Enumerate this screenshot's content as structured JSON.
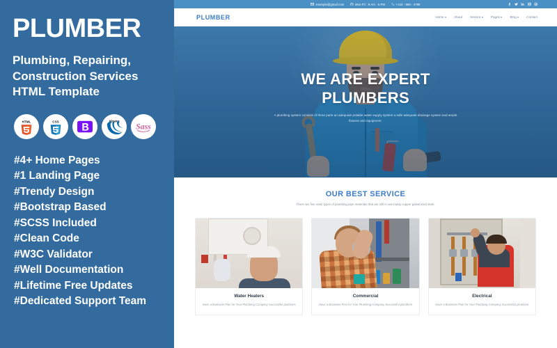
{
  "promo": {
    "title": "PLUMBER",
    "subtitle_lines": [
      "Plumbing, Repairing,",
      "Construction Services",
      "HTML Template"
    ],
    "badges": [
      {
        "name": "html5-badge",
        "label": "HTML5"
      },
      {
        "name": "css3-badge",
        "label": "CSS3"
      },
      {
        "name": "bootstrap-badge",
        "label": "Bootstrap"
      },
      {
        "name": "jquery-badge",
        "label": "jQuery"
      },
      {
        "name": "sass-badge",
        "label": "Sass"
      }
    ],
    "features": [
      "#4+ Home Pages",
      "#1 Landing Page",
      "#Trendy Design",
      "#Bootstrap Based",
      "#SCSS Included",
      "#Clean Code",
      "#W3C Validator",
      "#Well Documentation",
      "#Lifetime Free Updates",
      "#Dedicated Support Team"
    ],
    "background_color": "#336b9e"
  },
  "preview": {
    "topbar": {
      "email": "example@gmail.com",
      "hours": "Mon-Fri : 9 Am - 5 PM",
      "phone": "+123 - 666 - 4789",
      "background_color": "#4a90c4",
      "socials": [
        "facebook-icon",
        "twitter-icon",
        "linkedin-icon",
        "instagram-icon",
        "pinterest-icon"
      ]
    },
    "navbar": {
      "logo": "PLUMBER",
      "logo_color": "#3d7cc9",
      "links": [
        {
          "label": "Home",
          "has_caret": true
        },
        {
          "label": "About",
          "has_caret": false
        },
        {
          "label": "Service",
          "has_caret": true
        },
        {
          "label": "Pages",
          "has_caret": true
        },
        {
          "label": "Blog",
          "has_caret": true
        },
        {
          "label": "Contact",
          "has_caret": false
        }
      ]
    },
    "hero": {
      "heading_line1": "WE ARE EXPERT",
      "heading_line2": "PLUMBERS",
      "paragraph": "A plumbing system consists of three parts an adequate potable water supply system a safe adequate drainage system and ample fixtures and equipment."
    },
    "service": {
      "title": "OUR BEST SERVICE",
      "subtitle": "There are five main types of plumbing pipe materials that are still in use today copper galvanized steel.",
      "title_color": "#3d7cc9",
      "cards": [
        {
          "title": "Water Heaters",
          "text": "Have a Business Plan for Your Plumbing Company Successful plumbers",
          "image_name": "water-heater-photo"
        },
        {
          "title": "Commercial",
          "text": "Have a Business Plan for Your Plumbing Company Successful plumbers",
          "image_name": "commercial-plumbing-photo"
        },
        {
          "title": "Electrical",
          "text": "Have a Business Plan for Your Plumbing Company Successful plumbers",
          "image_name": "electrical-panel-photo"
        }
      ]
    }
  }
}
